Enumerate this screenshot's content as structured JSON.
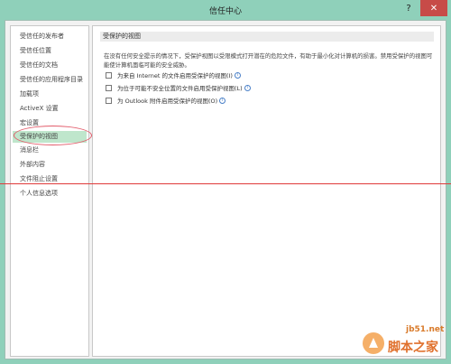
{
  "window": {
    "title": "信任中心",
    "help_label": "?",
    "close_label": "✕"
  },
  "sidebar": {
    "items": [
      {
        "label": "受信任的发布者"
      },
      {
        "label": "受信任位置"
      },
      {
        "label": "受信任的文档"
      },
      {
        "label": "受信任的应用程序目录"
      },
      {
        "label": "加载项"
      },
      {
        "label": "ActiveX 设置"
      },
      {
        "label": "宏设置"
      },
      {
        "label": "受保护的视图",
        "active": true
      },
      {
        "label": "消息栏"
      },
      {
        "label": "外部内容"
      },
      {
        "label": "文件阻止设置"
      },
      {
        "label": "个人信息选项"
      }
    ]
  },
  "main": {
    "section_title": "受保护的视图",
    "description": "在没有任何安全提示的情况下，受保护视图以受限模式打开潜在的危险文件，有助于最小化对计算机的损害。禁用受保护的视图可能使计算机面临可能的安全威胁。",
    "options": [
      {
        "label": "为来自 Internet 的文件启用受保护的视图(I)",
        "checked": false,
        "info": true
      },
      {
        "label": "为位于可能不安全位置的文件启用受保护视图(L)",
        "checked": false,
        "info": true
      },
      {
        "label": "为 Outlook 附件启用受保护的视图(O)",
        "checked": false,
        "info": true
      }
    ]
  },
  "watermark": {
    "site": "jb51.net",
    "name": "脚本之家"
  },
  "colors": {
    "frame": "#8fd0ba",
    "close_button": "#c74b48",
    "active_item": "#bfe6cc",
    "annotation_oval": "#e25b6a",
    "annotation_line": "#e03a3a"
  }
}
